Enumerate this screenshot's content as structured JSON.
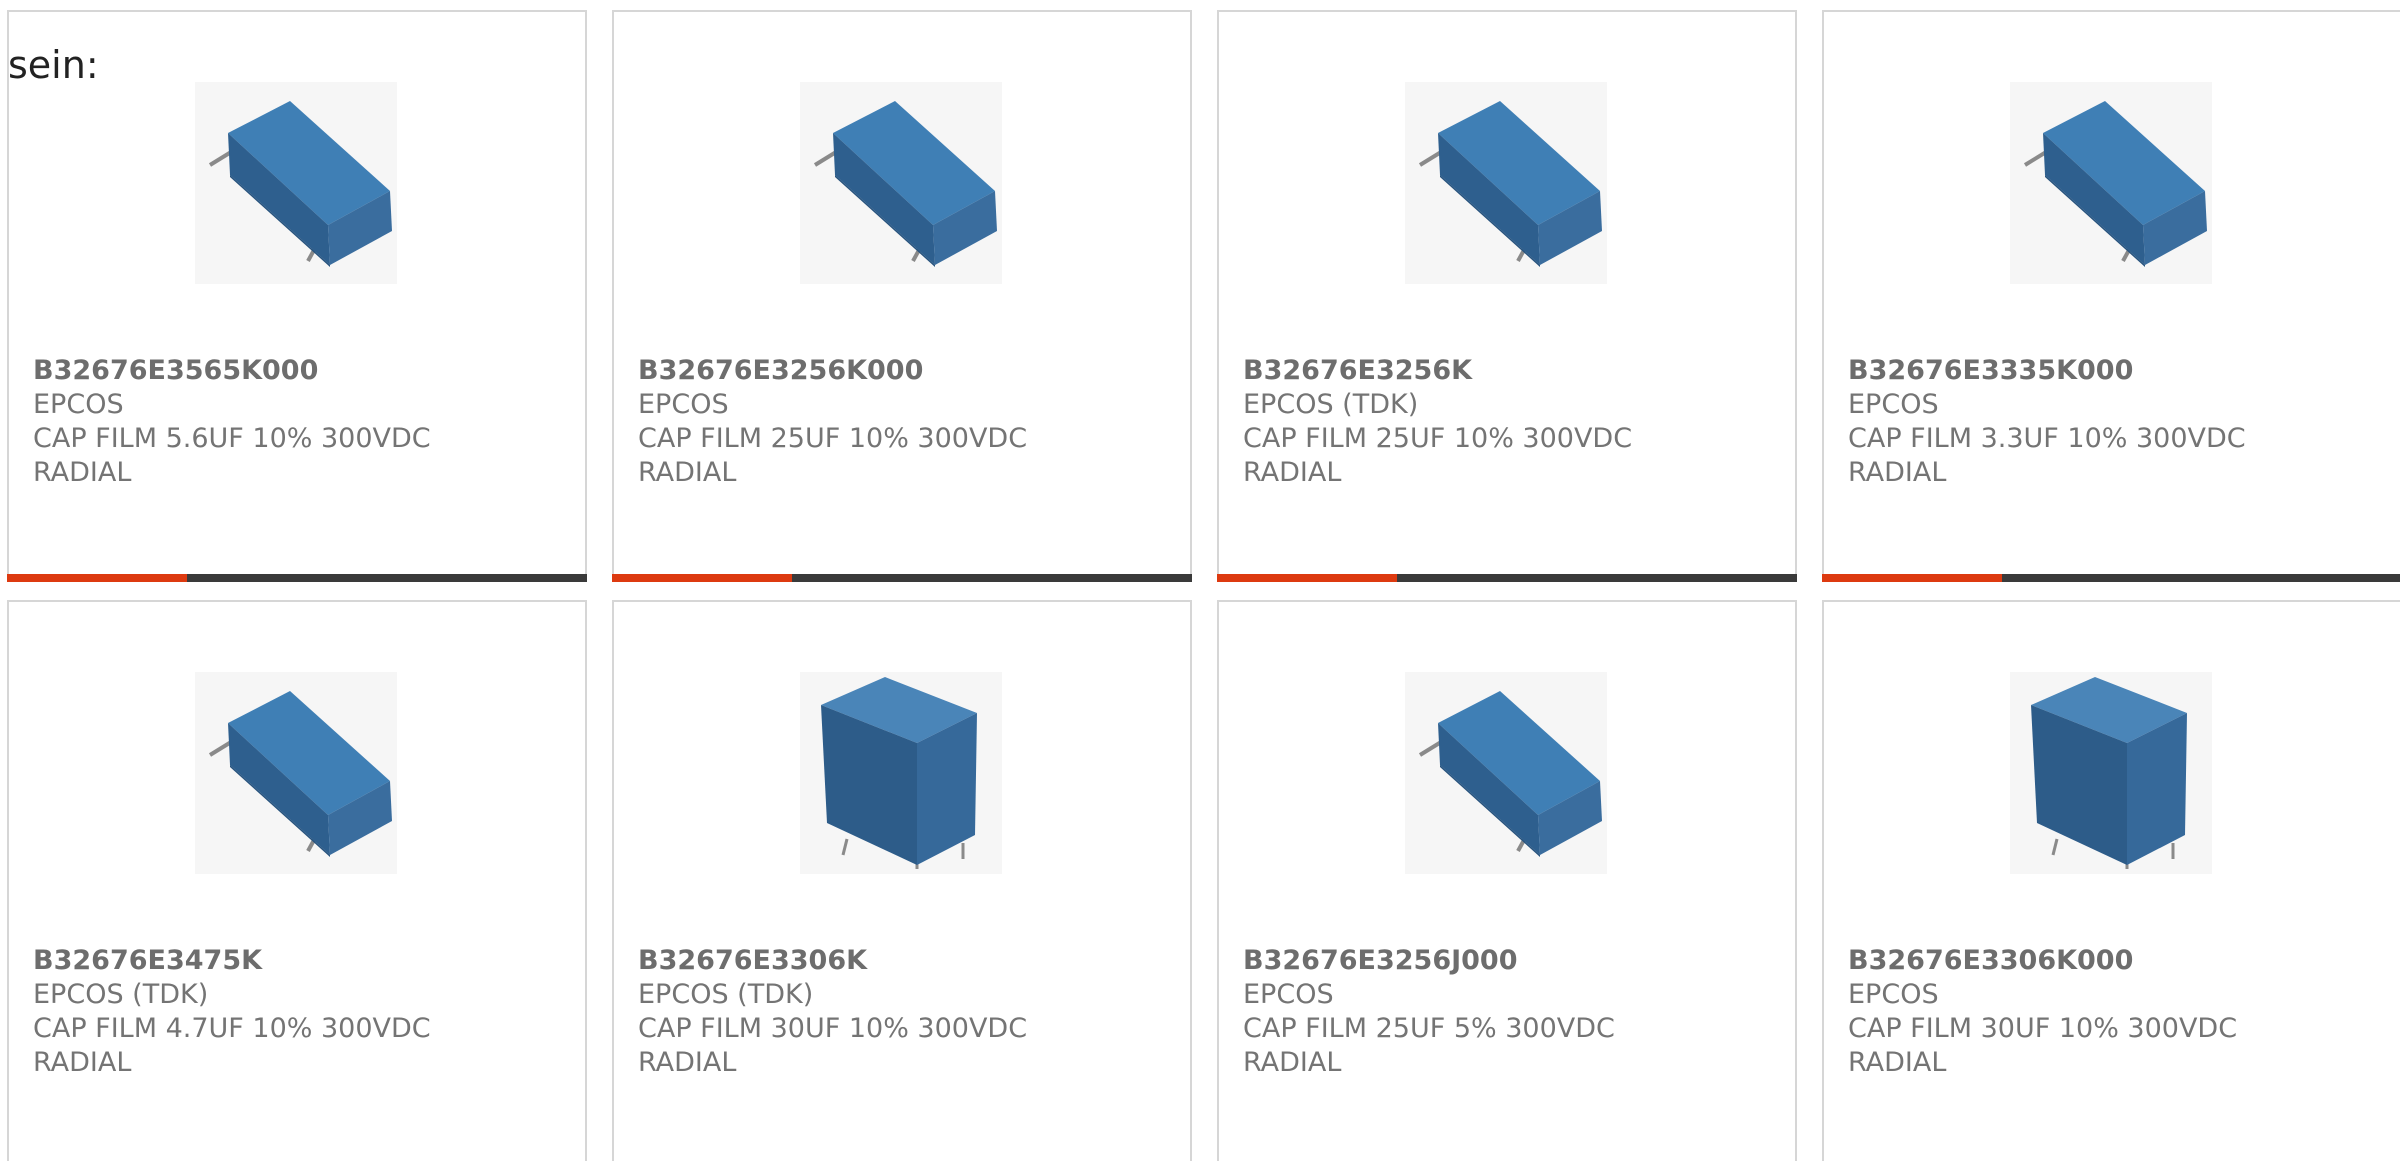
{
  "intro_text": "sein:",
  "colors": {
    "accent": "#dd3a10",
    "bar_track": "#3a3a3a",
    "card_border": "#d6d6d6",
    "text_muted": "#747474"
  },
  "products": [
    {
      "part_number": "B32676E3565K000",
      "manufacturer": "EPCOS",
      "description": "CAP FILM 5.6UF 10% 300VDC",
      "mounting": "RADIAL",
      "image_icon": "film-capacitor-landscape-icon",
      "progress_fraction": 0.31
    },
    {
      "part_number": "B32676E3256K000",
      "manufacturer": "EPCOS",
      "description": "CAP FILM 25UF 10% 300VDC",
      "mounting": "RADIAL",
      "image_icon": "film-capacitor-landscape-icon",
      "progress_fraction": 0.31
    },
    {
      "part_number": "B32676E3256K",
      "manufacturer": "EPCOS (TDK)",
      "description": "CAP FILM 25UF 10% 300VDC",
      "mounting": "RADIAL",
      "image_icon": "film-capacitor-landscape-icon",
      "progress_fraction": 0.31
    },
    {
      "part_number": "B32676E3335K000",
      "manufacturer": "EPCOS",
      "description": "CAP FILM 3.3UF 10% 300VDC",
      "mounting": "RADIAL",
      "image_icon": "film-capacitor-landscape-icon",
      "progress_fraction": 0.31
    },
    {
      "part_number": "B32676E3475K",
      "manufacturer": "EPCOS (TDK)",
      "description": "CAP FILM 4.7UF 10% 300VDC",
      "mounting": "RADIAL",
      "image_icon": "film-capacitor-landscape-icon",
      "progress_fraction": null
    },
    {
      "part_number": "B32676E3306K",
      "manufacturer": "EPCOS (TDK)",
      "description": "CAP FILM 30UF 10% 300VDC",
      "mounting": "RADIAL",
      "image_icon": "film-capacitor-upright-icon",
      "progress_fraction": null
    },
    {
      "part_number": "B32676E3256J000",
      "manufacturer": "EPCOS",
      "description": "CAP FILM 25UF 5% 300VDC",
      "mounting": "RADIAL",
      "image_icon": "film-capacitor-landscape-icon",
      "progress_fraction": null
    },
    {
      "part_number": "B32676E3306K000",
      "manufacturer": "EPCOS",
      "description": "CAP FILM 30UF 10% 300VDC",
      "mounting": "RADIAL",
      "image_icon": "film-capacitor-upright-icon",
      "progress_fraction": null
    }
  ]
}
